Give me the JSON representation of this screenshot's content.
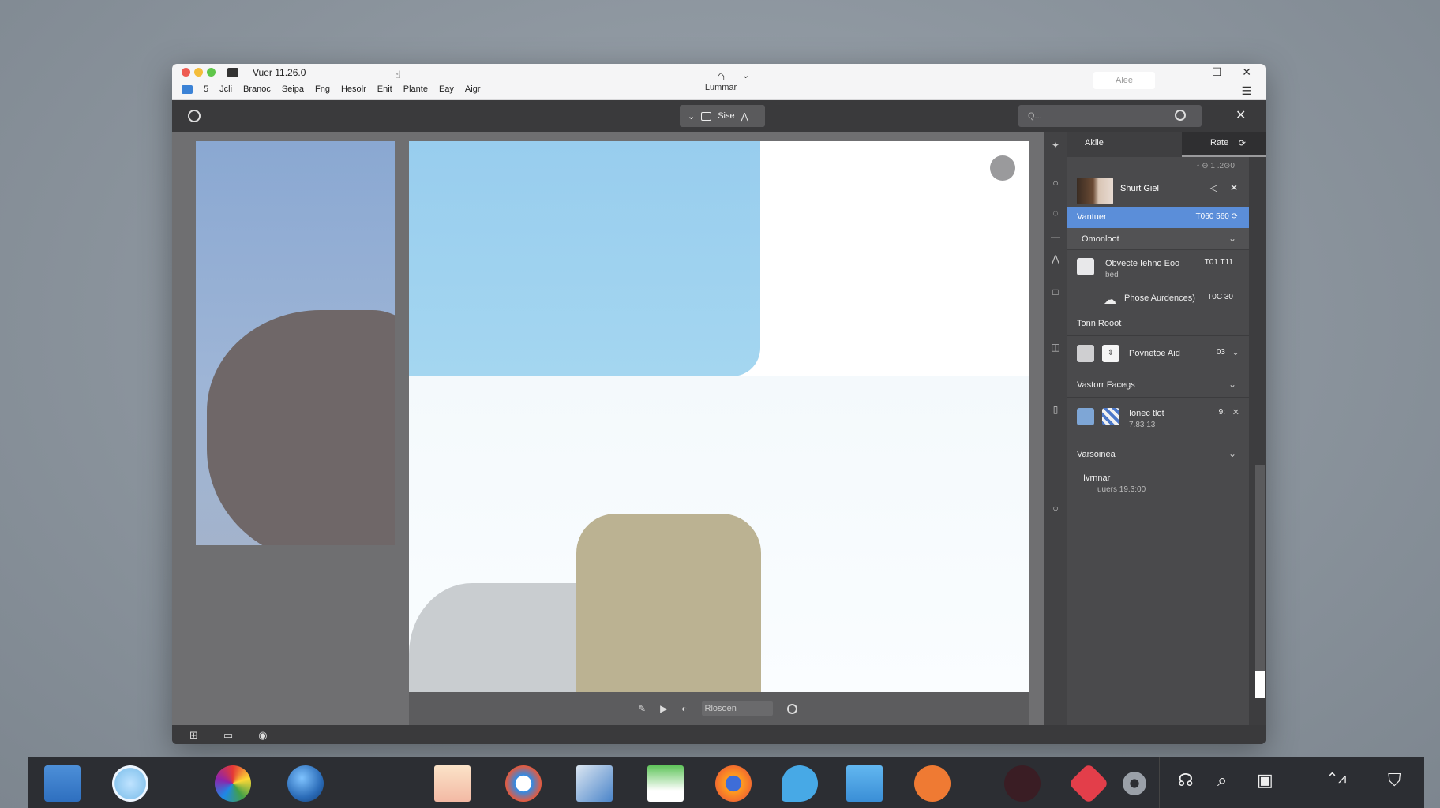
{
  "window": {
    "title": "Vuer 11.26.0",
    "menu": [
      "5",
      "Jcli",
      "Branoc",
      "Seipa",
      "Fng",
      "Hesolr",
      "Enit",
      "Plante",
      "Eay",
      "Aigr"
    ],
    "center_label": "Lummar",
    "field_text": "Alee",
    "controls": [
      "—",
      "☐",
      "✕"
    ]
  },
  "toolbar": {
    "center_label": "Sise",
    "search_placeholder": "Q..."
  },
  "canvas_bar": {
    "field_text": "Rlosoen"
  },
  "panel": {
    "tab_a": "Akile",
    "tab_b": "Rate",
    "meta": "◦ ⊖ 1 .2⊙0",
    "avatar_name": "Shurt Giel",
    "highlight": {
      "label": "Vantuer",
      "value": "T060  560 ⟳"
    },
    "section_1": "Omonloot",
    "item_1": {
      "title": "Obvecte Iehno Eoo",
      "sub": "bed",
      "value": "T01  T11"
    },
    "item_2": {
      "title": "Phose Aurdences)",
      "value": "T0C  30"
    },
    "label_tona": "Tonn Rooot",
    "item_3": {
      "title": "Povnetoe Aid",
      "value": "03"
    },
    "section_2": "Vastorr Facegs",
    "item_4": {
      "title": "Ionec tlot",
      "sub": "7.83   13",
      "value": "9:"
    },
    "section_3": "Varsoinea",
    "item_5": {
      "title": "Ivrnnar",
      "sub": "uuers   19.3:00"
    }
  },
  "colors": {
    "accent": "#5b8ed9",
    "canvas_blue": "#98cdee",
    "olive": "#bbb292",
    "dark_blob": "#6f6768"
  },
  "taskbar_apps": [
    "finder-icon",
    "circle-app-icon",
    "color-wheel-icon",
    "globe-icon",
    "notes-icon",
    "safari-icon",
    "files-icon",
    "photos-icon",
    "firefox-icon",
    "chat-icon",
    "calendar-icon",
    "orange-app-icon",
    "dark-app-icon",
    "red-app-icon",
    "settings-icon"
  ]
}
